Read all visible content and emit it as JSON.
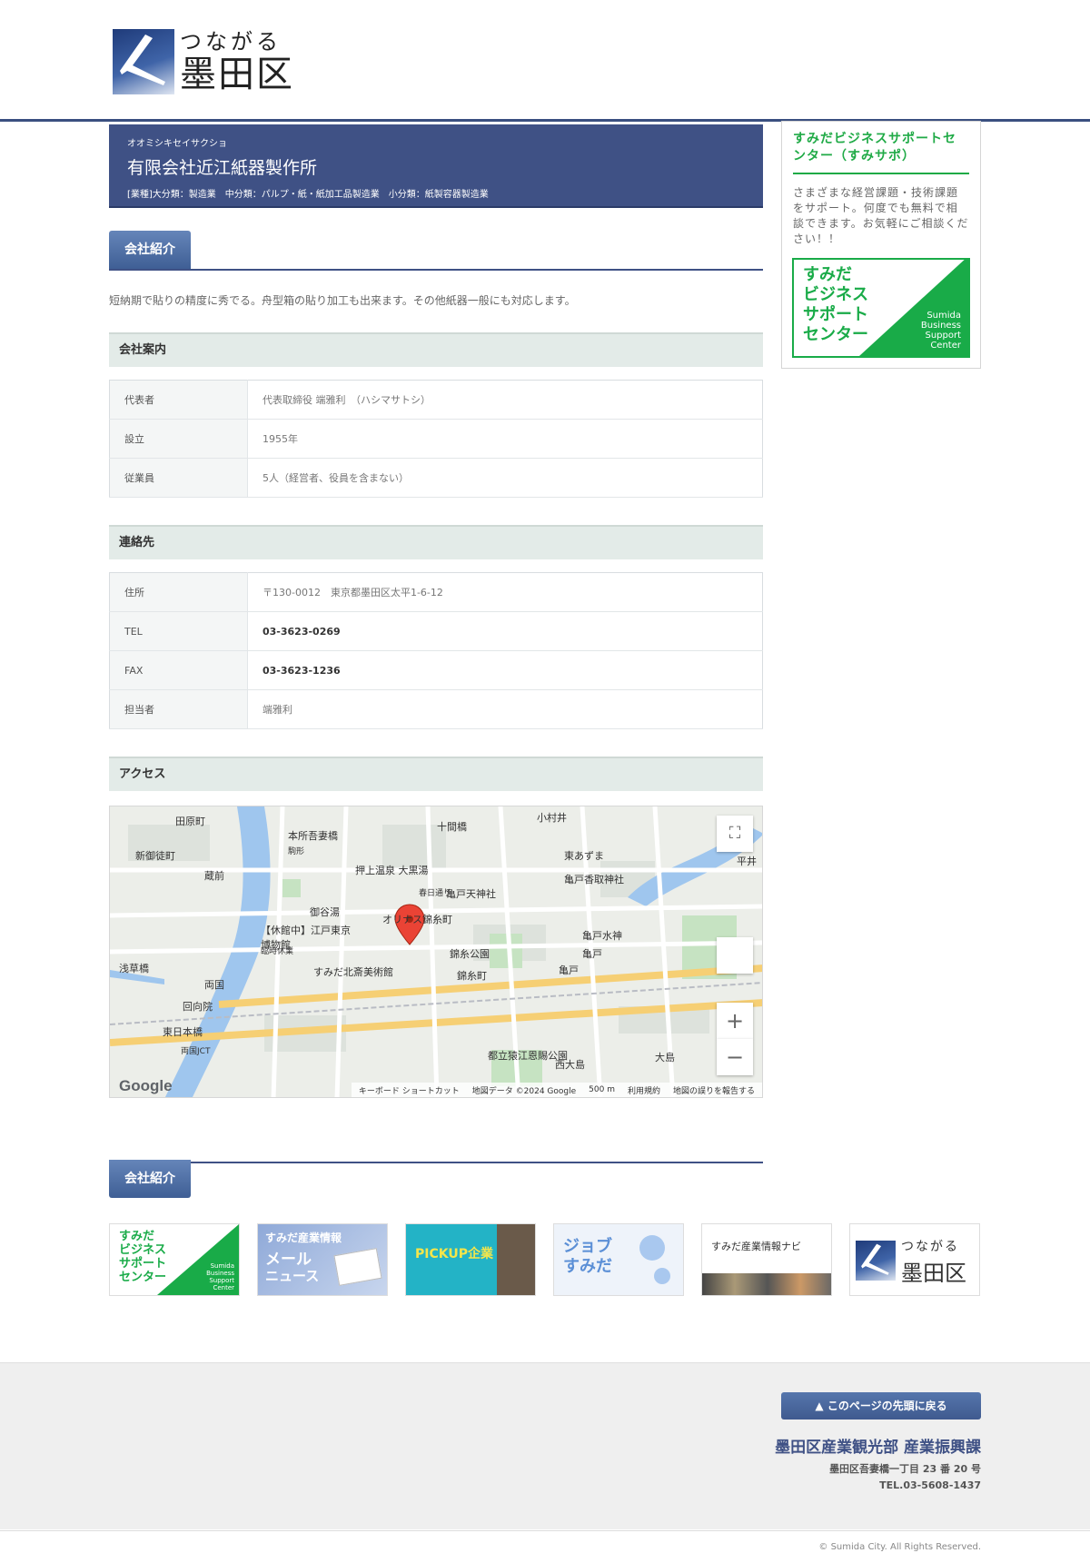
{
  "header": {
    "logo_small": "つながる",
    "logo_big": "墨田区"
  },
  "company": {
    "kana": "オオミシキセイサクショ",
    "name": "有限会社近江紙器製作所",
    "category": "[業種]大分類：製造業　中分類：パルプ・紙・紙加工品製造業　小分類：紙製容器製造業"
  },
  "sections": {
    "intro_tab": "会社紹介",
    "intro_text": "短納期で貼りの精度に秀でる。舟型箱の貼り加工も出来ます。その他紙器一般にも対応します。",
    "overview": "会社案内",
    "contact": "連絡先",
    "access": "アクセス",
    "intro_tab2": "会社紹介"
  },
  "overview_rows": [
    {
      "key": "代表者",
      "value": "代表取締役 端雅利　（ハシマサトシ）"
    },
    {
      "key": "設立",
      "value": "1955年"
    },
    {
      "key": "従業員",
      "value": "5人（経営者、役員を含まない）"
    }
  ],
  "contact_rows": [
    {
      "key": "住所",
      "value": "〒130-0012　東京都墨田区太平1-6-12"
    },
    {
      "key": "TEL",
      "value": "03-3623-0269"
    },
    {
      "key": "FAX",
      "value": "03-3623-1236"
    },
    {
      "key": "担当者",
      "value": "端雅利"
    }
  ],
  "map": {
    "labels": [
      "田原町",
      "本所吾妻橋",
      "十間橋",
      "小村井",
      "東あずま",
      "平井",
      "新御徒町",
      "蔵前",
      "押上温泉 大黒湯",
      "亀戸香取神社",
      "亀戸天神社",
      "御谷湯",
      "オリナス錦糸町",
      "【休館中】江戸東京博物館",
      "錦糸公園",
      "亀戸水神",
      "亀戸",
      "浅草橋",
      "両国",
      "すみだ北斎美術館",
      "錦糸町",
      "亀戸",
      "回向院",
      "東日本橋",
      "両国JCT",
      "都立猿江恩賜公園",
      "大島",
      "臨時休業",
      "駒形",
      "春日通り",
      "西大島"
    ],
    "footer": [
      "キーボード ショートカット",
      "地図データ ©2024 Google",
      "500 m",
      "利用規約",
      "地図の誤りを報告する"
    ],
    "google": "Google"
  },
  "sidebar": {
    "title": "すみだビジネスサポートセンター（すみサポ）",
    "text": "さまざまな経営課題・技術課題をサポート。何度でも無料で相談できます。お気軽にご相談ください！！",
    "banner_jp": "すみだ\nビジネス\nサポート\nセンター",
    "banner_en": "Sumida\nBusiness\nSupport\nCenter"
  },
  "banners": [
    {
      "name": "すみだビジネスサポートセンター",
      "jp": "すみだ\nビジネス\nサポート\nセンター",
      "en": "Sumida\nBusiness\nSupport\nCenter"
    },
    {
      "name": "すみだ産業情報メールニュース",
      "line1": "すみだ産業情報",
      "line2": "メール",
      "line3": "ニュース"
    },
    {
      "name": "PICKUP企業",
      "text": "PICKUP企業"
    },
    {
      "name": "ジョブすみだ",
      "text": "ジョブ\nすみだ"
    },
    {
      "name": "すみだ産業情報ナビ",
      "text": "すみだ産業情報ナビ"
    },
    {
      "name": "つながる墨田区",
      "small": "つながる",
      "big": "墨田区"
    }
  ],
  "footer": {
    "totop": "▲ このページの先頭に戻る",
    "org": "墨田区産業観光部 産業振興課",
    "address": "墨田区吾妻橋一丁目 23 番 20 号",
    "tel": "TEL.03-5608-1437",
    "copyright": "© Sumida City. All Rights Reserved."
  },
  "colors": {
    "navy": "#3f5185",
    "green": "#19ab48",
    "band": "#e3ebe8"
  }
}
